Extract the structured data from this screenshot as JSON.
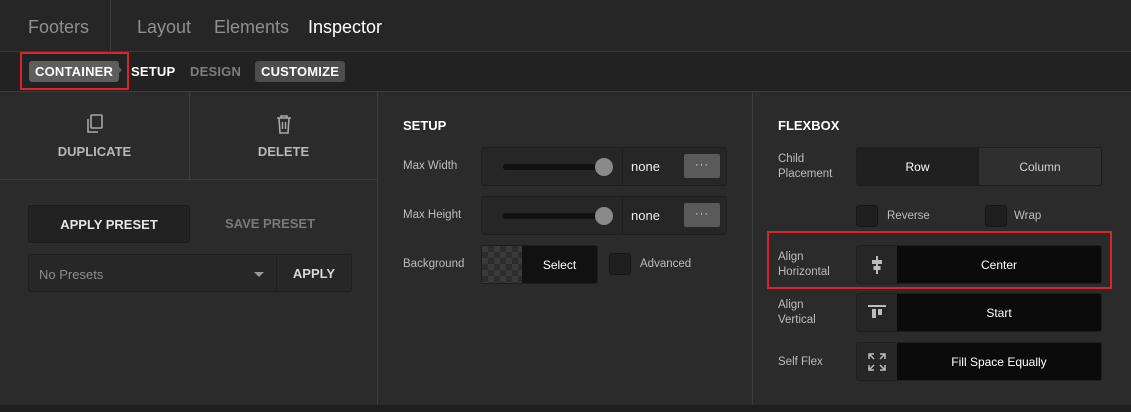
{
  "tabs": {
    "footers": "Footers",
    "layout": "Layout",
    "elements": "Elements",
    "inspector": "Inspector"
  },
  "breadcrumb": {
    "container": "CONTAINER",
    "setup": "SETUP",
    "design": "DESIGN",
    "customize": "CUSTOMIZE"
  },
  "left": {
    "duplicate_label": "DUPLICATE",
    "delete_label": "DELETE",
    "apply_preset_label": "APPLY PRESET",
    "save_preset_label": "SAVE PRESET",
    "preset_select_value": "No Presets",
    "apply_label": "APPLY"
  },
  "setup": {
    "title": "SETUP",
    "max_width_label": "Max Width",
    "max_width_value": "none",
    "max_width_slider_fraction": 1.0,
    "max_height_label": "Max Height",
    "max_height_value": "none",
    "max_height_slider_fraction": 1.0,
    "more_label": "···",
    "background_label": "Background",
    "background_select": "Select",
    "advanced_label": "Advanced"
  },
  "flexbox": {
    "title": "FLEXBOX",
    "child_placement_label": "Child Placement",
    "row_label": "Row",
    "column_label": "Column",
    "reverse_label": "Reverse",
    "wrap_label": "Wrap",
    "align_horizontal_label": "Align Horizontal",
    "align_horizontal_value": "Center",
    "align_vertical_label": "Align Vertical",
    "align_vertical_value": "Start",
    "self_flex_label": "Self Flex",
    "self_flex_value": "Fill Space Equally"
  },
  "colors": {
    "highlight": "#d6262c",
    "background": "#2b2b2b"
  }
}
